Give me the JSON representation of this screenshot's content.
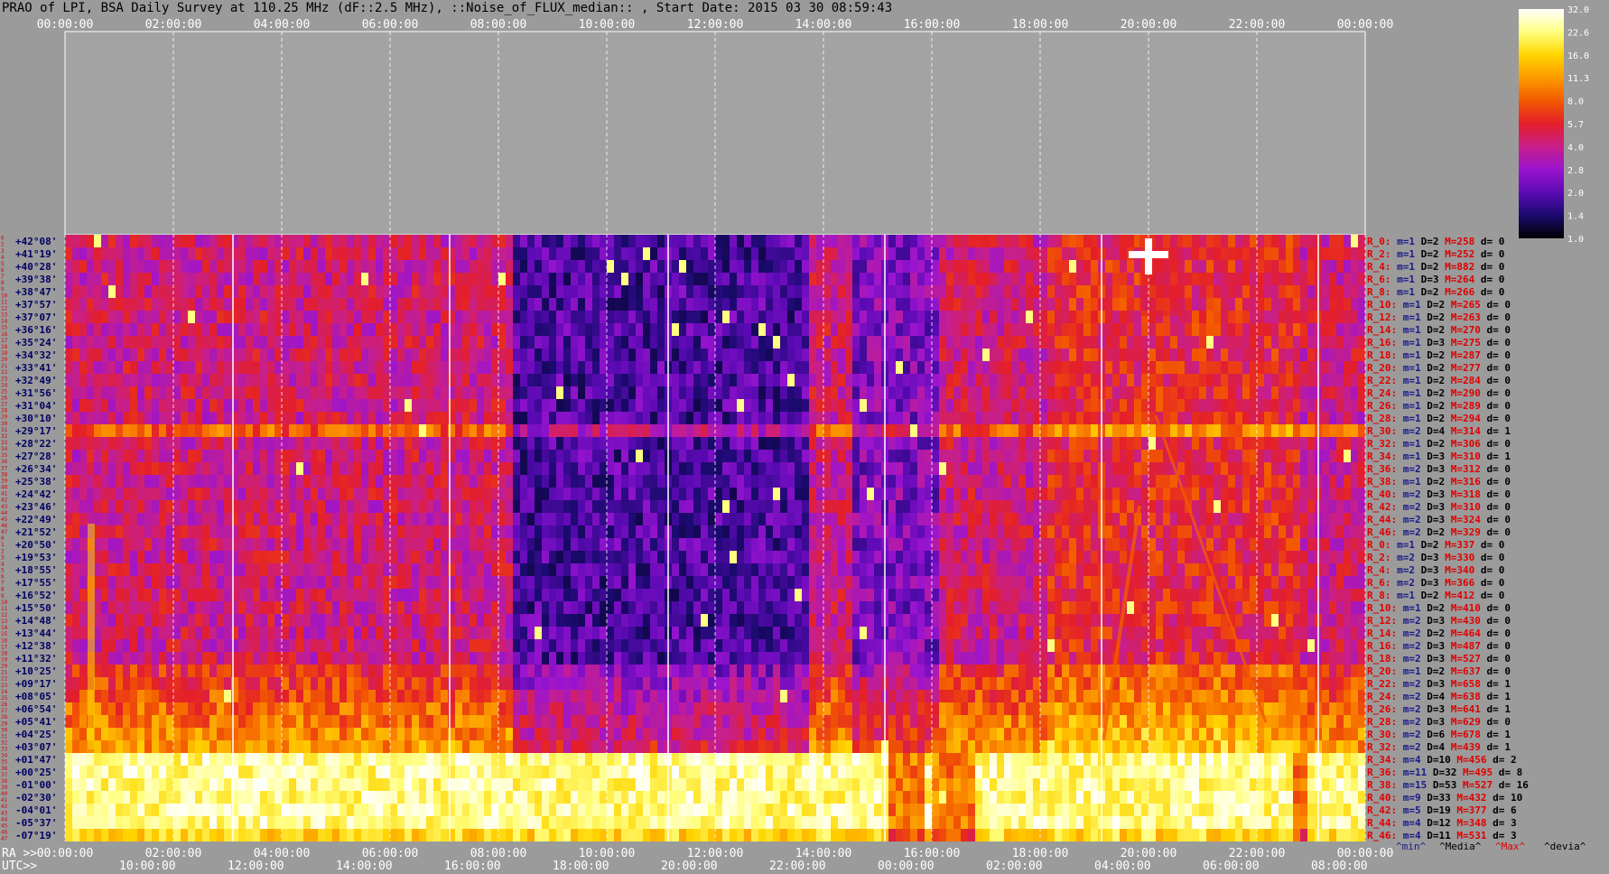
{
  "title": "PRAO of LPI, BSA Daily Survey at 110.25 MHz (dF::2.5 MHz), ::Noise_of_FLUX_median:: , Start Date: 2015 03 30 08:59:43",
  "chart_data": {
    "type": "heatmap",
    "top_time_ticks": [
      "00:00:00",
      "02:00:00",
      "04:00:00",
      "06:00:00",
      "08:00:00",
      "10:00:00",
      "12:00:00",
      "14:00:00",
      "16:00:00",
      "18:00:00",
      "20:00:00",
      "22:00:00",
      "00:00:00"
    ],
    "ra_prefix": "RA >>",
    "ra_ticks": [
      "00:00:00",
      "02:00:00",
      "04:00:00",
      "06:00:00",
      "08:00:00",
      "10:00:00",
      "12:00:00",
      "14:00:00",
      "16:00:00",
      "18:00:00",
      "20:00:00",
      "22:00:00",
      "00:00:00"
    ],
    "utc_prefix": "UTC>>",
    "utc_ticks": [
      "10:00:00",
      "12:00:00",
      "14:00:00",
      "16:00:00",
      "18:00:00",
      "20:00:00",
      "22:00:00",
      "00:00:00",
      "02:00:00",
      "04:00:00",
      "06:00:00",
      "08:00:00"
    ],
    "colorbar_ticks": [
      "32.0",
      "22.6",
      "16.0",
      "11.3",
      "8.0",
      "5.7",
      "4.0",
      "2.8",
      "2.0",
      "1.4",
      "1.0"
    ],
    "colorbar_colors": [
      "#000000",
      "#1a0a6e",
      "#5b0ab4",
      "#9a14d0",
      "#c81f8a",
      "#e41f2a",
      "#f35a00",
      "#fc9a00",
      "#ffd500",
      "#ffff80",
      "#ffffff"
    ],
    "row_numbers": [
      "0",
      "2",
      "3",
      "4",
      "5",
      "6",
      "7",
      "8",
      "9",
      "10",
      "11",
      "12",
      "13",
      "14",
      "15",
      "16",
      "17",
      "18",
      "19",
      "20",
      "21",
      "22",
      "23",
      "24",
      "25",
      "26",
      "27",
      "28",
      "29",
      "30",
      "31",
      "32",
      "33",
      "34",
      "35",
      "36",
      "37",
      "38",
      "39",
      "40",
      "41",
      "42",
      "43",
      "44",
      "45",
      "46",
      "47",
      "0",
      "1",
      "2",
      "3",
      "4",
      "5",
      "6",
      "7",
      "8",
      "9",
      "10",
      "11",
      "12",
      "13",
      "14",
      "15",
      "16",
      "17",
      "18",
      "19",
      "20",
      "21",
      "22",
      "23",
      "24",
      "25",
      "26",
      "27",
      "28",
      "29",
      "30",
      "31",
      "32",
      "33",
      "34",
      "35",
      "36",
      "37",
      "38",
      "39",
      "40",
      "41",
      "42",
      "43",
      "44",
      "45",
      "46",
      "47"
    ],
    "declinations": [
      "+42°08'",
      "+41°19'",
      "+40°28'",
      "+39°38'",
      "+38°47'",
      "+37°57'",
      "+37°07'",
      "+36°16'",
      "+35°24'",
      "+34°32'",
      "+33°41'",
      "+32°49'",
      "+31°56'",
      "+31°04'",
      "+30°10'",
      "+29°17'",
      "+28°22'",
      "+27°28'",
      "+26°34'",
      "+25°38'",
      "+24°42'",
      "+23°46'",
      "+22°49'",
      "+21°52'",
      "+20°50'",
      "+19°53'",
      "+18°55'",
      "+17°55'",
      "+16°52'",
      "+15°50'",
      "+14°48'",
      "+13°44'",
      "+12°38'",
      "+11°32'",
      "+10°25'",
      "+09°17'",
      "+08°05'",
      "+06°54'",
      "+05°41'",
      "+04°25'",
      "+03°07'",
      "+01°47'",
      "+00°25'",
      "-01°00'",
      "-02°30'",
      "-04°01'",
      "-05°37'",
      "-07°19'"
    ],
    "stats": [
      {
        "r": "R_0:",
        "m": "m=1",
        "D": "D=2",
        "M": "M=258",
        "d": "d= 0"
      },
      {
        "r": "R_2:",
        "m": "m=1",
        "D": "D=2",
        "M": "M=252",
        "d": "d= 0"
      },
      {
        "r": "R_4:",
        "m": "m=1",
        "D": "D=2",
        "M": "M=882",
        "d": "d= 0"
      },
      {
        "r": "R_6:",
        "m": "m=1",
        "D": "D=3",
        "M": "M=264",
        "d": "d= 0"
      },
      {
        "r": "R_8:",
        "m": "m=1",
        "D": "D=2",
        "M": "M=266",
        "d": "d= 0"
      },
      {
        "r": "R_10:",
        "m": "m=1",
        "D": "D=2",
        "M": "M=265",
        "d": "d= 0"
      },
      {
        "r": "R_12:",
        "m": "m=1",
        "D": "D=2",
        "M": "M=263",
        "d": "d= 0"
      },
      {
        "r": "R_14:",
        "m": "m=1",
        "D": "D=2",
        "M": "M=270",
        "d": "d= 0"
      },
      {
        "r": "R_16:",
        "m": "m=1",
        "D": "D=3",
        "M": "M=275",
        "d": "d= 0"
      },
      {
        "r": "R_18:",
        "m": "m=1",
        "D": "D=2",
        "M": "M=287",
        "d": "d= 0"
      },
      {
        "r": "R_20:",
        "m": "m=1",
        "D": "D=2",
        "M": "M=277",
        "d": "d= 0"
      },
      {
        "r": "R_22:",
        "m": "m=1",
        "D": "D=2",
        "M": "M=284",
        "d": "d= 0"
      },
      {
        "r": "R_24:",
        "m": "m=1",
        "D": "D=2",
        "M": "M=290",
        "d": "d= 0"
      },
      {
        "r": "R_26:",
        "m": "m=1",
        "D": "D=2",
        "M": "M=289",
        "d": "d= 0"
      },
      {
        "r": "R_28:",
        "m": "m=1",
        "D": "D=2",
        "M": "M=294",
        "d": "d= 0"
      },
      {
        "r": "R_30:",
        "m": "m=2",
        "D": "D=4",
        "M": "M=314",
        "d": "d= 1"
      },
      {
        "r": "R_32:",
        "m": "m=1",
        "D": "D=2",
        "M": "M=306",
        "d": "d= 0"
      },
      {
        "r": "R_34:",
        "m": "m=1",
        "D": "D=3",
        "M": "M=310",
        "d": "d= 1"
      },
      {
        "r": "R_36:",
        "m": "m=2",
        "D": "D=3",
        "M": "M=312",
        "d": "d= 0"
      },
      {
        "r": "R_38:",
        "m": "m=1",
        "D": "D=2",
        "M": "M=316",
        "d": "d= 0"
      },
      {
        "r": "R_40:",
        "m": "m=2",
        "D": "D=3",
        "M": "M=318",
        "d": "d= 0"
      },
      {
        "r": "R_42:",
        "m": "m=2",
        "D": "D=3",
        "M": "M=310",
        "d": "d= 0"
      },
      {
        "r": "R_44:",
        "m": "m=2",
        "D": "D=3",
        "M": "M=324",
        "d": "d= 0"
      },
      {
        "r": "R_46:",
        "m": "m=2",
        "D": "D=2",
        "M": "M=329",
        "d": "d= 0"
      },
      {
        "r": "R_0:",
        "m": "m=1",
        "D": "D=2",
        "M": "M=337",
        "d": "d= 0"
      },
      {
        "r": "R_2:",
        "m": "m=2",
        "D": "D=3",
        "M": "M=330",
        "d": "d= 0"
      },
      {
        "r": "R_4:",
        "m": "m=2",
        "D": "D=3",
        "M": "M=340",
        "d": "d= 0"
      },
      {
        "r": "R_6:",
        "m": "m=2",
        "D": "D=3",
        "M": "M=366",
        "d": "d= 0"
      },
      {
        "r": "R_8:",
        "m": "m=1",
        "D": "D=2",
        "M": "M=412",
        "d": "d= 0"
      },
      {
        "r": "R_10:",
        "m": "m=1",
        "D": "D=2",
        "M": "M=410",
        "d": "d= 0"
      },
      {
        "r": "R_12:",
        "m": "m=2",
        "D": "D=3",
        "M": "M=430",
        "d": "d= 0"
      },
      {
        "r": "R_14:",
        "m": "m=2",
        "D": "D=2",
        "M": "M=464",
        "d": "d= 0"
      },
      {
        "r": "R_16:",
        "m": "m=2",
        "D": "D=3",
        "M": "M=487",
        "d": "d= 0"
      },
      {
        "r": "R_18:",
        "m": "m=2",
        "D": "D=3",
        "M": "M=527",
        "d": "d= 0"
      },
      {
        "r": "R_20:",
        "m": "m=1",
        "D": "D=2",
        "M": "M=637",
        "d": "d= 0"
      },
      {
        "r": "R_22:",
        "m": "m=2",
        "D": "D=3",
        "M": "M=658",
        "d": "d= 1"
      },
      {
        "r": "R_24:",
        "m": "m=2",
        "D": "D=4",
        "M": "M=638",
        "d": "d= 1"
      },
      {
        "r": "R_26:",
        "m": "m=2",
        "D": "D=3",
        "M": "M=641",
        "d": "d= 1"
      },
      {
        "r": "R_28:",
        "m": "m=2",
        "D": "D=3",
        "M": "M=629",
        "d": "d= 0"
      },
      {
        "r": "R_30:",
        "m": "m=2",
        "D": "D=6",
        "M": "M=678",
        "d": "d= 1"
      },
      {
        "r": "R_32:",
        "m": "m=2",
        "D": "D=4",
        "M": "M=439",
        "d": "d= 1"
      },
      {
        "r": "R_34:",
        "m": "m=4",
        "D": "D=10",
        "M": "M=456",
        "d": "d= 2"
      },
      {
        "r": "R_36:",
        "m": "m=11",
        "D": "D=32",
        "M": "M=495",
        "d": "d= 8"
      },
      {
        "r": "R_38:",
        "m": "m=15",
        "D": "D=53",
        "M": "M=527",
        "d": "d= 16"
      },
      {
        "r": "R_40:",
        "m": "m=9",
        "D": "D=33",
        "M": "M=432",
        "d": "d= 10"
      },
      {
        "r": "R_42:",
        "m": "m=5",
        "D": "D=19",
        "M": "M=377",
        "d": "d= 6"
      },
      {
        "r": "R_44:",
        "m": "m=4",
        "D": "D=12",
        "M": "M=348",
        "d": "d= 3"
      },
      {
        "r": "R_46:",
        "m": "m=4",
        "D": "D=11",
        "M": "M=531",
        "d": "d= 3"
      }
    ],
    "legend_labels": [
      "^min^",
      "^Media^",
      "^Max^",
      "^devia^"
    ],
    "legend_colors": [
      "#1a1a8c",
      "#000000",
      "#e00000",
      "#000000"
    ]
  }
}
